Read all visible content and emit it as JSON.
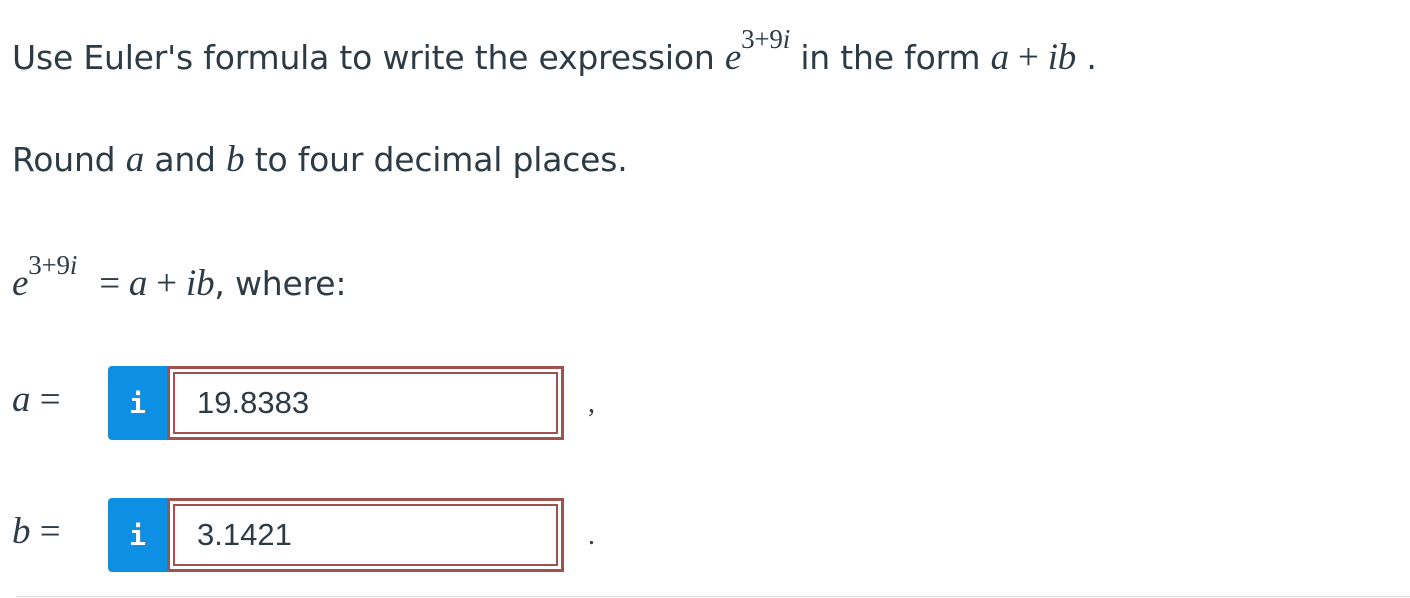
{
  "question": {
    "instruction": {
      "before": "Use Euler's formula to write the expression ",
      "exp_base": "e",
      "exp_power_num": "3+9",
      "exp_power_var": "i",
      "middle": " in the form ",
      "form_a": "a",
      "form_plus": " + ",
      "form_ib": "ib",
      "end": " ."
    },
    "rounding": {
      "prefix": "Round ",
      "var_a": "a",
      "mid": " and ",
      "var_b": "b",
      "suffix": " to four decimal places."
    },
    "equation": {
      "base": "e",
      "power_num": "3+9",
      "power_var": "i",
      "equals": "= ",
      "a": "a",
      "plus": " + ",
      "ib": "ib",
      "tail": ", where:"
    }
  },
  "answers": {
    "a": {
      "label_var": "a",
      "label_eq": " =",
      "info_icon": "i",
      "value": "19.8383",
      "trailing": ","
    },
    "b": {
      "label_var": "b",
      "label_eq": " =",
      "info_icon": "i",
      "value": "3.1421",
      "trailing": "."
    }
  },
  "colors": {
    "info_button": "#0d8fe3",
    "field_border": "#a0524f",
    "text": "#2d3b45"
  },
  "icons": {
    "info": "info-icon"
  }
}
